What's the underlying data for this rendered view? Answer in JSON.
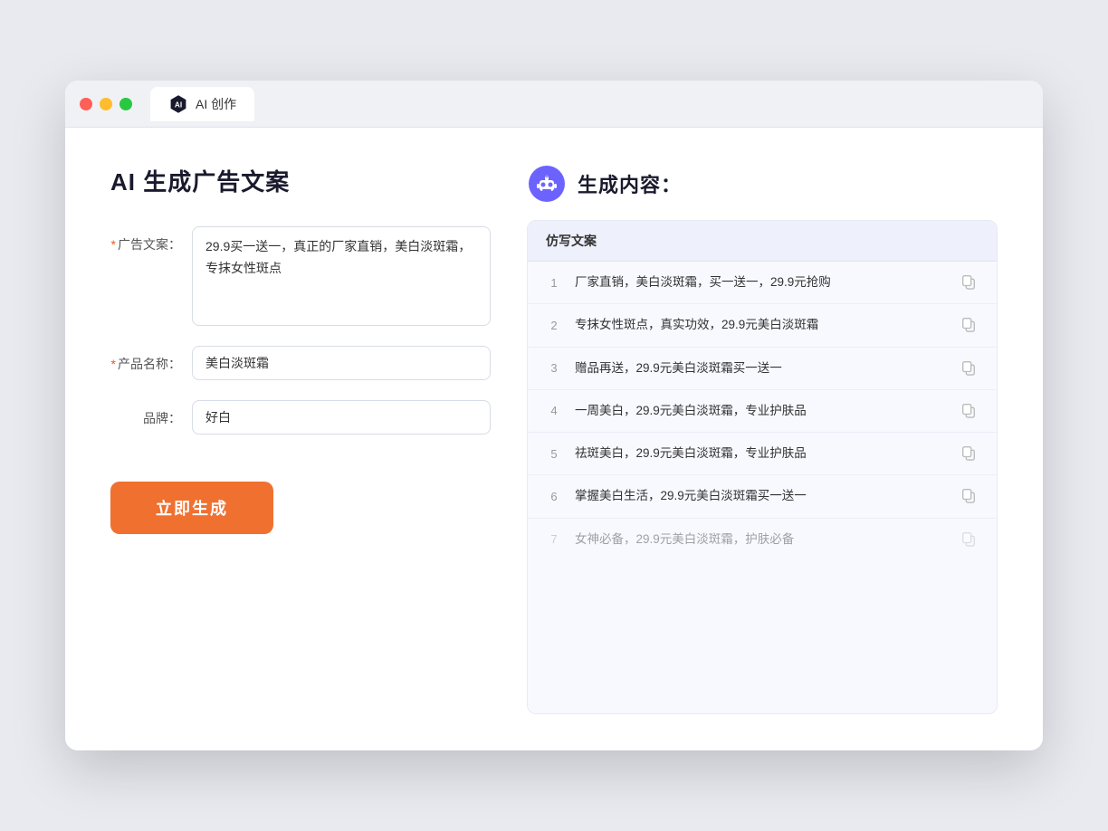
{
  "browser": {
    "tab_label": "AI 创作"
  },
  "page": {
    "title": "AI 生成广告文案",
    "result_title": "生成内容："
  },
  "form": {
    "ad_copy_label": "广告文案：",
    "ad_copy_required": true,
    "ad_copy_value": "29.9买一送一，真正的厂家直销，美白淡斑霜，专抹女性斑点",
    "product_name_label": "产品名称：",
    "product_name_required": true,
    "product_name_value": "美白淡斑霜",
    "brand_label": "品牌：",
    "brand_required": false,
    "brand_value": "好白",
    "generate_button_label": "立即生成"
  },
  "results": {
    "table_header": "仿写文案",
    "items": [
      {
        "num": "1",
        "text": "厂家直销，美白淡斑霜，买一送一，29.9元抢购",
        "dimmed": false
      },
      {
        "num": "2",
        "text": "专抹女性斑点，真实功效，29.9元美白淡斑霜",
        "dimmed": false
      },
      {
        "num": "3",
        "text": "赠品再送，29.9元美白淡斑霜买一送一",
        "dimmed": false
      },
      {
        "num": "4",
        "text": "一周美白，29.9元美白淡斑霜，专业护肤品",
        "dimmed": false
      },
      {
        "num": "5",
        "text": "祛斑美白，29.9元美白淡斑霜，专业护肤品",
        "dimmed": false
      },
      {
        "num": "6",
        "text": "掌握美白生活，29.9元美白淡斑霜买一送一",
        "dimmed": false
      },
      {
        "num": "7",
        "text": "女神必备，29.9元美白淡斑霜，护肤必备",
        "dimmed": true
      }
    ]
  }
}
